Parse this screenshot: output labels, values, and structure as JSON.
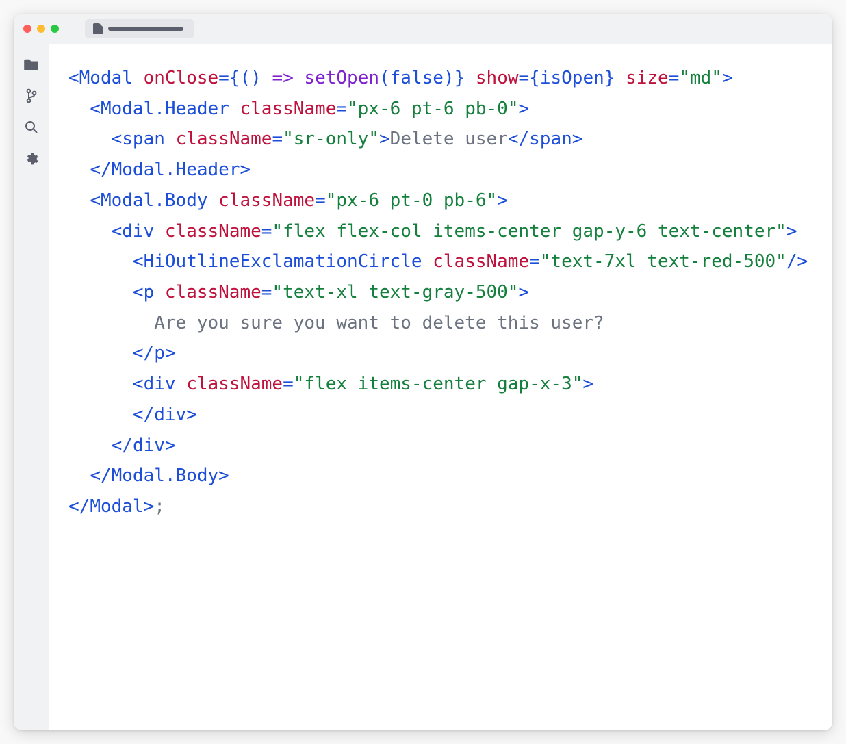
{
  "sidebar": {
    "items": [
      {
        "name": "files-icon"
      },
      {
        "name": "git-icon"
      },
      {
        "name": "search-icon"
      },
      {
        "name": "gear-icon"
      }
    ]
  },
  "code": {
    "lines": [
      [
        {
          "cls": "tok-punc",
          "text": "<"
        },
        {
          "cls": "tok-comp",
          "text": "Modal"
        },
        {
          "cls": "tok-text",
          "text": " "
        },
        {
          "cls": "tok-attr",
          "text": "onClose"
        },
        {
          "cls": "tok-punc",
          "text": "={() "
        },
        {
          "cls": "tok-fn",
          "text": "=>"
        },
        {
          "cls": "tok-text",
          "text": " "
        },
        {
          "cls": "tok-fn",
          "text": "setOpen"
        },
        {
          "cls": "tok-punc",
          "text": "("
        },
        {
          "cls": "tok-kw",
          "text": "false"
        },
        {
          "cls": "tok-punc",
          "text": ")}"
        },
        {
          "cls": "tok-text",
          "text": " "
        },
        {
          "cls": "tok-attr",
          "text": "show"
        },
        {
          "cls": "tok-punc",
          "text": "={"
        },
        {
          "cls": "tok-comp",
          "text": "isOpen"
        },
        {
          "cls": "tok-punc",
          "text": "} "
        },
        {
          "cls": "tok-attr",
          "text": "size"
        },
        {
          "cls": "tok-punc",
          "text": "="
        },
        {
          "cls": "tok-str",
          "text": "\"md\""
        },
        {
          "cls": "tok-punc",
          "text": ">"
        }
      ],
      [
        {
          "cls": "tok-text",
          "text": "  "
        },
        {
          "cls": "tok-punc",
          "text": "<"
        },
        {
          "cls": "tok-comp",
          "text": "Modal.Header"
        },
        {
          "cls": "tok-text",
          "text": " "
        },
        {
          "cls": "tok-attr",
          "text": "className"
        },
        {
          "cls": "tok-punc",
          "text": "="
        },
        {
          "cls": "tok-str",
          "text": "\"px-6 pt-6 pb-0\""
        },
        {
          "cls": "tok-punc",
          "text": ">"
        }
      ],
      [
        {
          "cls": "tok-text",
          "text": "    "
        },
        {
          "cls": "tok-punc",
          "text": "<"
        },
        {
          "cls": "tok-comp",
          "text": "span"
        },
        {
          "cls": "tok-text",
          "text": " "
        },
        {
          "cls": "tok-attr",
          "text": "className"
        },
        {
          "cls": "tok-punc",
          "text": "="
        },
        {
          "cls": "tok-str",
          "text": "\"sr-only\""
        },
        {
          "cls": "tok-punc",
          "text": ">"
        },
        {
          "cls": "tok-text",
          "text": "Delete user"
        },
        {
          "cls": "tok-punc",
          "text": "</"
        },
        {
          "cls": "tok-comp",
          "text": "span"
        },
        {
          "cls": "tok-punc",
          "text": ">"
        }
      ],
      [
        {
          "cls": "tok-text",
          "text": "  "
        },
        {
          "cls": "tok-punc",
          "text": "</"
        },
        {
          "cls": "tok-comp",
          "text": "Modal.Header"
        },
        {
          "cls": "tok-punc",
          "text": ">"
        }
      ],
      [
        {
          "cls": "tok-text",
          "text": "  "
        },
        {
          "cls": "tok-punc",
          "text": "<"
        },
        {
          "cls": "tok-comp",
          "text": "Modal.Body"
        },
        {
          "cls": "tok-text",
          "text": " "
        },
        {
          "cls": "tok-attr",
          "text": "className"
        },
        {
          "cls": "tok-punc",
          "text": "="
        },
        {
          "cls": "tok-str",
          "text": "\"px-6 pt-0 pb-6\""
        },
        {
          "cls": "tok-punc",
          "text": ">"
        }
      ],
      [
        {
          "cls": "tok-text",
          "text": "    "
        },
        {
          "cls": "tok-punc",
          "text": "<"
        },
        {
          "cls": "tok-comp",
          "text": "div"
        },
        {
          "cls": "tok-text",
          "text": " "
        },
        {
          "cls": "tok-attr",
          "text": "className"
        },
        {
          "cls": "tok-punc",
          "text": "="
        },
        {
          "cls": "tok-str",
          "text": "\"flex flex-col items-center gap-y-6 text-center\""
        },
        {
          "cls": "tok-punc",
          "text": ">"
        }
      ],
      [
        {
          "cls": "tok-text",
          "text": "      "
        },
        {
          "cls": "tok-punc",
          "text": "<"
        },
        {
          "cls": "tok-comp",
          "text": "HiOutlineExclamationCircle"
        },
        {
          "cls": "tok-text",
          "text": " "
        },
        {
          "cls": "tok-attr",
          "text": "className"
        },
        {
          "cls": "tok-punc",
          "text": "="
        },
        {
          "cls": "tok-str",
          "text": "\"text-7xl text-red-500\""
        },
        {
          "cls": "tok-punc",
          "text": "/>"
        }
      ],
      [
        {
          "cls": "tok-text",
          "text": "      "
        },
        {
          "cls": "tok-punc",
          "text": "<"
        },
        {
          "cls": "tok-comp",
          "text": "p"
        },
        {
          "cls": "tok-text",
          "text": " "
        },
        {
          "cls": "tok-attr",
          "text": "className"
        },
        {
          "cls": "tok-punc",
          "text": "="
        },
        {
          "cls": "tok-str",
          "text": "\"text-xl text-gray-500\""
        },
        {
          "cls": "tok-punc",
          "text": ">"
        }
      ],
      [
        {
          "cls": "tok-text",
          "text": "        Are you sure you want to delete this user?"
        }
      ],
      [
        {
          "cls": "tok-text",
          "text": "      "
        },
        {
          "cls": "tok-punc",
          "text": "</"
        },
        {
          "cls": "tok-comp",
          "text": "p"
        },
        {
          "cls": "tok-punc",
          "text": ">"
        }
      ],
      [
        {
          "cls": "tok-text",
          "text": "      "
        },
        {
          "cls": "tok-punc",
          "text": "<"
        },
        {
          "cls": "tok-comp",
          "text": "div"
        },
        {
          "cls": "tok-text",
          "text": " "
        },
        {
          "cls": "tok-attr",
          "text": "className"
        },
        {
          "cls": "tok-punc",
          "text": "="
        },
        {
          "cls": "tok-str",
          "text": "\"flex items-center gap-x-3\""
        },
        {
          "cls": "tok-punc",
          "text": ">"
        }
      ],
      [
        {
          "cls": "tok-text",
          "text": "      "
        },
        {
          "cls": "tok-punc",
          "text": "</"
        },
        {
          "cls": "tok-comp",
          "text": "div"
        },
        {
          "cls": "tok-punc",
          "text": ">"
        }
      ],
      [
        {
          "cls": "tok-text",
          "text": "    "
        },
        {
          "cls": "tok-punc",
          "text": "</"
        },
        {
          "cls": "tok-comp",
          "text": "div"
        },
        {
          "cls": "tok-punc",
          "text": ">"
        }
      ],
      [
        {
          "cls": "tok-text",
          "text": "  "
        },
        {
          "cls": "tok-punc",
          "text": "</"
        },
        {
          "cls": "tok-comp",
          "text": "Modal.Body"
        },
        {
          "cls": "tok-punc",
          "text": ">"
        }
      ],
      [
        {
          "cls": "tok-punc",
          "text": "</"
        },
        {
          "cls": "tok-comp",
          "text": "Modal"
        },
        {
          "cls": "tok-punc",
          "text": ">"
        },
        {
          "cls": "tok-text",
          "text": ";"
        }
      ]
    ]
  }
}
